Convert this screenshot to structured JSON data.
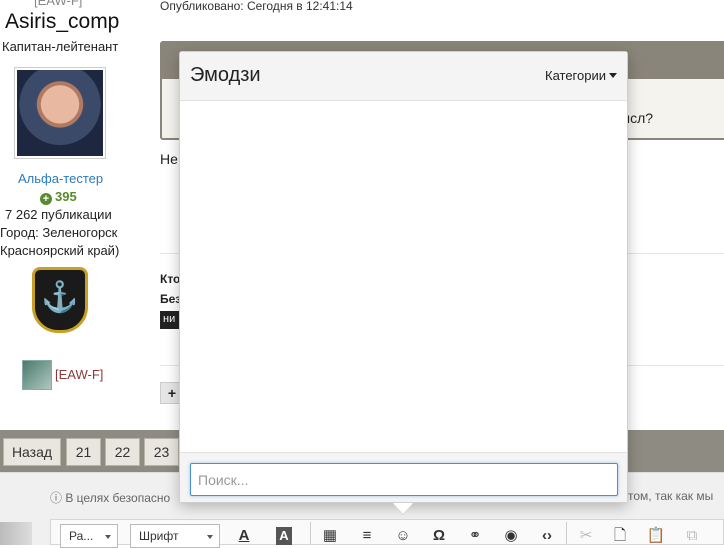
{
  "profile": {
    "clan_tag_top": "[EAW-F]",
    "username": "Asiris_comp",
    "rank": "Капитан-лейтенант",
    "group": "Альфа-тестер",
    "reputation": "395",
    "posts": "7 262 публикации",
    "city": "Город: Зеленогорск",
    "region": "Красноярский край)",
    "clan_link": "[EAW-F]"
  },
  "post": {
    "published": "Опубликовано: Сегодня в 12:41:14",
    "behind_question_tail": "ысл?",
    "behind_text_start": "Не",
    "behind_who": "Кто",
    "behind_without": "Без",
    "behind_dark_label": "ни",
    "plus_label": "+"
  },
  "pagination": {
    "back_label": "Назад",
    "pages": [
      "21",
      "22",
      "23"
    ]
  },
  "reply": {
    "info_left": "В целях безопасно",
    "info_right": "том, так как мы"
  },
  "toolbar": {
    "format_select": "Ра...",
    "font_select": "Шрифт",
    "icons": [
      "font-color-icon",
      "background-color-icon",
      "table-icon",
      "align-icon",
      "emoji-icon",
      "special-char-icon",
      "link-icon",
      "preview-icon",
      "code-icon",
      "cut-icon",
      "copy-icon",
      "paste-icon",
      "paste-text-icon"
    ]
  },
  "emoji_modal": {
    "title": "Эмодзи",
    "categories_label": "Категории",
    "search_placeholder": "Поиск..."
  }
}
